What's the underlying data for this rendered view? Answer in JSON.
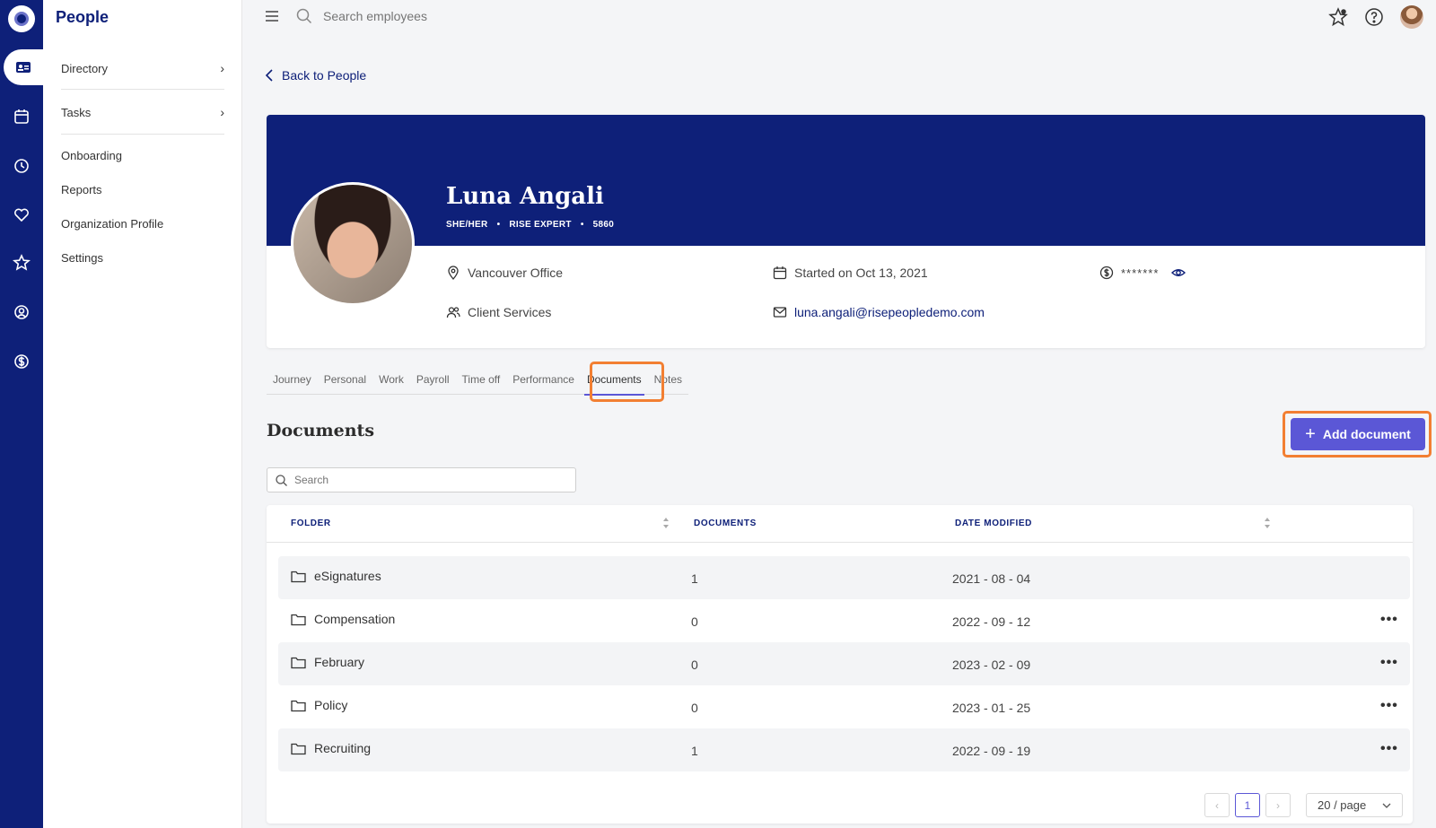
{
  "app": {
    "section_title": "People"
  },
  "colors": {
    "brand_navy": "#0e2079",
    "accent_purple": "#5b57d6",
    "highlight_orange": "#f27f32"
  },
  "rail": {
    "icons": [
      "people-card-icon",
      "calendar-icon",
      "clock-icon",
      "heart-icon",
      "star-icon",
      "search-person-icon",
      "dollar-icon"
    ],
    "active_index": 0
  },
  "sidebar": {
    "items": [
      {
        "label": "Directory",
        "chevron": "›"
      },
      {
        "label": "Tasks",
        "chevron": "›"
      },
      {
        "label": "Onboarding"
      },
      {
        "label": "Reports"
      },
      {
        "label": "Organization Profile"
      },
      {
        "label": "Settings"
      }
    ]
  },
  "topbar": {
    "search_placeholder": "Search employees"
  },
  "back_link": "Back to People",
  "profile": {
    "name": "Luna Angali",
    "pronouns": "SHE/HER",
    "title": "RISE EXPERT",
    "employee_id": "5860",
    "separator": "•",
    "office": "Vancouver Office",
    "department": "Client Services",
    "start_date": "Started on Oct 13, 2021",
    "email": "luna.angali@risepeopledemo.com",
    "salary_masked": "*******"
  },
  "tabs": [
    "Journey",
    "Personal",
    "Work",
    "Payroll",
    "Time off",
    "Performance",
    "Documents",
    "Notes"
  ],
  "active_tab": "Documents",
  "documents": {
    "title": "Documents",
    "add_label": "Add document",
    "search_placeholder": "Search",
    "columns": {
      "folder": "FOLDER",
      "documents": "DOCUMENTS",
      "date_modified": "DATE MODIFIED"
    },
    "rows": [
      {
        "folder": "eSignatures",
        "count": "1",
        "date": "2021 - 08 - 04",
        "menu": false
      },
      {
        "folder": "Compensation",
        "count": "0",
        "date": "2022 - 09 - 12",
        "menu": true
      },
      {
        "folder": "February",
        "count": "0",
        "date": "2023 - 02 - 09",
        "menu": true
      },
      {
        "folder": "Policy",
        "count": "0",
        "date": "2023 - 01 - 25",
        "menu": true
      },
      {
        "folder": "Recruiting",
        "count": "1",
        "date": "2022 - 09 - 19",
        "menu": true
      }
    ],
    "more_label": "•••",
    "pagination": {
      "prev": "‹",
      "current": "1",
      "next": "›",
      "page_size": "20 / page"
    }
  }
}
